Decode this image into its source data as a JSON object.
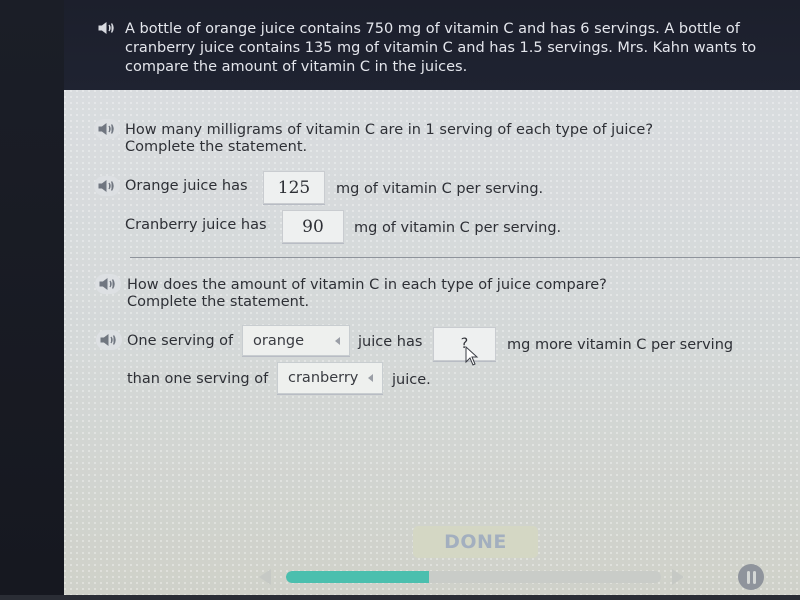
{
  "problem": {
    "intro_text": "A bottle of orange juice contains 750 mg of vitamin C and has 6 servings. A bottle of cranberry juice contains 135 mg of vitamin C and has 1.5 servings. Mrs. Kahn wants to compare the amount of vitamin C in the juices."
  },
  "part1": {
    "question_line1": "How many milligrams of vitamin C are in 1 serving of each type of juice?",
    "question_line2": "Complete the statement.",
    "orange_prefix": "Orange juice has",
    "orange_value": "125",
    "orange_suffix": "mg of vitamin C per serving.",
    "cranberry_prefix": "Cranberry juice has",
    "cranberry_value": "90",
    "cranberry_suffix": "mg of vitamin C per serving."
  },
  "part2": {
    "question_line1": "How does the amount of vitamin C in each type of juice compare?",
    "question_line2": "Complete the statement.",
    "prefix": "One serving of",
    "dropdown1_value": "orange",
    "middle": "juice has",
    "answer_value": "?",
    "suffix": "mg more vitamin C per serving",
    "line2_prefix": "than one serving of",
    "dropdown2_value": "cranberry",
    "line2_suffix": "juice."
  },
  "footer": {
    "done_label": "DONE",
    "progress_fraction": 0.38
  },
  "colors": {
    "progress_fill": "#4bbfae",
    "banner_bg": "#1f2331",
    "panel_bg": "#d7dadc"
  }
}
